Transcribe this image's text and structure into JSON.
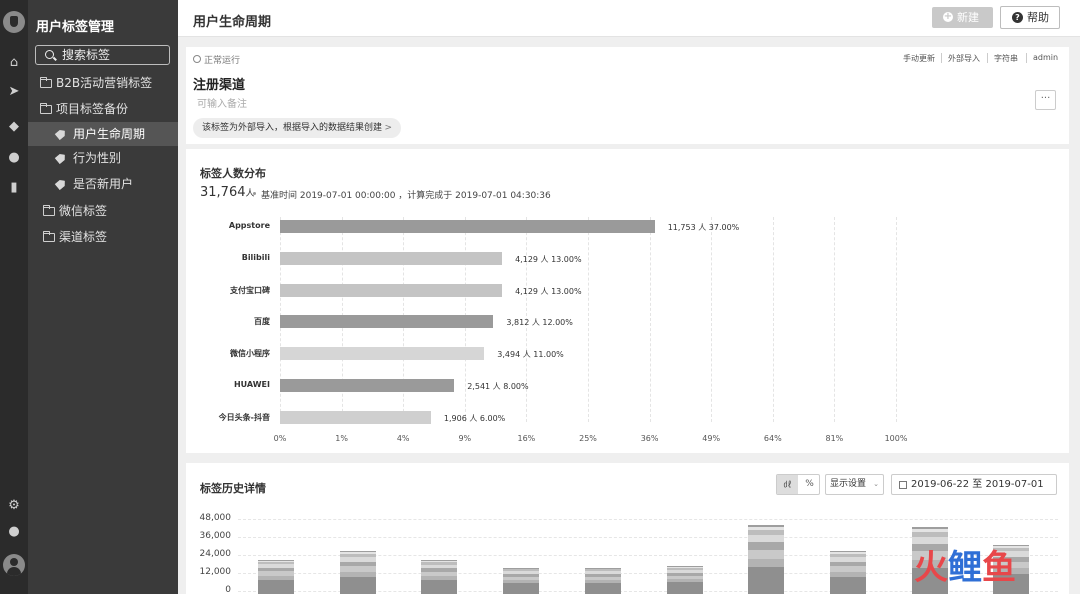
{
  "app": {
    "title": "用户标签管理"
  },
  "sidebar": {
    "search_label": "搜索标签",
    "items": [
      {
        "label": "B2B活动营销标签",
        "kind": "folder",
        "selected": false
      },
      {
        "label": "项目标签备份",
        "kind": "folder",
        "selected": false
      },
      {
        "label": "用户生命周期",
        "kind": "tag",
        "selected": true
      },
      {
        "label": "行为性别",
        "kind": "tag",
        "selected": false
      },
      {
        "label": "是否新用户",
        "kind": "tag",
        "selected": false
      },
      {
        "label": "微信标签",
        "kind": "folder",
        "selected": false
      },
      {
        "label": "渠道标签",
        "kind": "folder",
        "selected": false
      }
    ],
    "rail_icons": [
      "home-icon",
      "send-icon",
      "tag-icon",
      "user-icon",
      "bar-chart-icon",
      "gear-icon",
      "chat-icon",
      "avatar-icon"
    ]
  },
  "header": {
    "title": "用户生命周期",
    "new_label": "新建",
    "help_label": "帮助"
  },
  "tag_info": {
    "status": "正常运行",
    "meta": [
      "手动更新",
      "外部导入",
      "字符串",
      "admin"
    ],
    "name": "注册渠道",
    "remark_placeholder": "可输入备注",
    "more_label": "···",
    "hint": "该标签为外部导入，根据导入的数据结果创建",
    "hint_chevron": ">"
  },
  "distribution": {
    "title": "标签人数分布",
    "count": "31,764",
    "count_unit": "人",
    "details": "基准时间 2019-07-01 00:00:00 ，计算完成于 2019-07-01 04:30:36"
  },
  "chart_data": [
    {
      "type": "bar",
      "orientation": "horizontal",
      "title": "标签人数分布",
      "categories": [
        "Appstore",
        "Bilibili",
        "支付宝口碑",
        "百度",
        "微信小程序",
        "HUAWEI",
        "今日头条-抖音"
      ],
      "values": [
        11753,
        4129,
        4129,
        3812,
        3494,
        2541,
        1906
      ],
      "percent": [
        37.0,
        13.0,
        13.0,
        12.0,
        11.0,
        8.0,
        6.0
      ],
      "labels": [
        "11,753 人 37.00%",
        "4,129 人 13.00%",
        "4,129 人 13.00%",
        "3,812 人 12.00%",
        "3,494 人 11.00%",
        "2,541 人 8.00%",
        "1,906 人 6.00%"
      ],
      "bar_colors": [
        "#9a9a9a",
        "#c4c4c4",
        "#c4c4c4",
        "#9a9a9a",
        "#d6d6d6",
        "#9a9a9a",
        "#cfcfcf"
      ],
      "x_ticks": [
        "0%",
        "1%",
        "4%",
        "9%",
        "16%",
        "25%",
        "36%",
        "49%",
        "64%",
        "81%",
        "100%"
      ],
      "x_scale": "sqrt",
      "grid": true
    },
    {
      "type": "bar",
      "stacked": true,
      "title": "标签历史详情",
      "y_ticks": [
        "48,000",
        "36,000",
        "24,000",
        "12,000",
        "0"
      ],
      "ylim": [
        0,
        48000
      ],
      "totals": [
        21000,
        26500,
        20500,
        15500,
        15500,
        16500,
        44000,
        26500,
        42500,
        31000
      ],
      "date_range": "2019-06-22 至 2019-07-01",
      "grid": true
    }
  ],
  "history": {
    "title": "标签历史详情",
    "seg_chart": "㎗",
    "seg_percent": "%",
    "display_settings": "显示设置",
    "display_caret": "⌄",
    "date_range": "2019-06-22 至 2019-07-01"
  },
  "watermark": {
    "chars": [
      "火",
      "鲤",
      "鱼"
    ]
  }
}
